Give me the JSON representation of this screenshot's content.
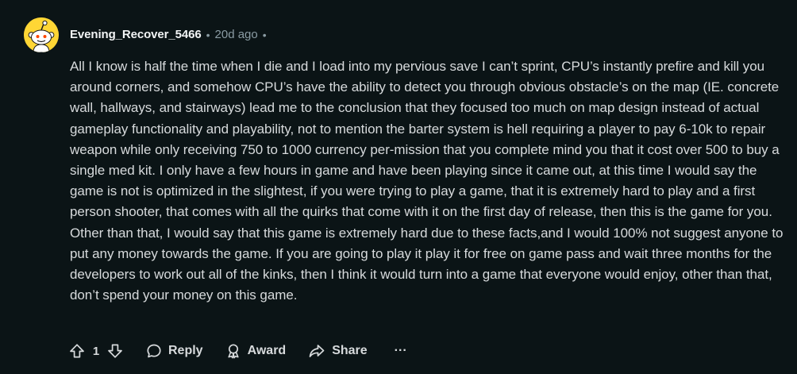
{
  "comment": {
    "author": "Evening_Recover_5466",
    "separator": "•",
    "age": "20d ago",
    "trailing_separator": "•",
    "body": "All I know is half the time when I die and I load into my pervious save I can’t sprint, CPU’s instantly prefire and kill you around corners, and somehow CPU’s have the ability to detect you through obvious obstacle’s on the map (IE. concrete wall, hallways, and stairways) lead me to the conclusion that they focused too much on map design instead of actual gameplay functionality and playability, not to mention the barter system is hell requiring a player to pay 6-10k to repair weapon while only receiving 750 to 1000 currency per-mission that you complete mind you that it cost over 500 to buy a single med kit. I only have a few hours in game and have been playing since it came out, at this time I would say the game is not is optimized in the slightest, if you were trying to play a game, that it is extremely hard to play and a first person shooter, that comes with all the quirks that come with it on the first day of release, then this is the game for you. Other than that, I would say that this game is extremely hard due to these facts,and I would 100% not suggest anyone to put any money towards the game. If you are going to play it play it for free on game pass and wait three months for the developers to work out all of the kinks, then I think it would turn into a game that everyone would enjoy, other than that, don’t spend your money on this game."
  },
  "actions": {
    "score": "1",
    "reply_label": "Reply",
    "award_label": "Award",
    "share_label": "Share",
    "more_label": "···"
  },
  "icons": {
    "avatar": "snoo-avatar-icon",
    "upvote": "upvote-arrow-icon",
    "downvote": "downvote-arrow-icon",
    "reply": "speech-bubble-icon",
    "award": "award-ribbon-icon",
    "share": "share-arrow-icon"
  },
  "colors": {
    "background": "#0b1416",
    "text": "#d7dadc",
    "muted": "#8a9ba3",
    "avatar_bg": "#ffd635"
  }
}
